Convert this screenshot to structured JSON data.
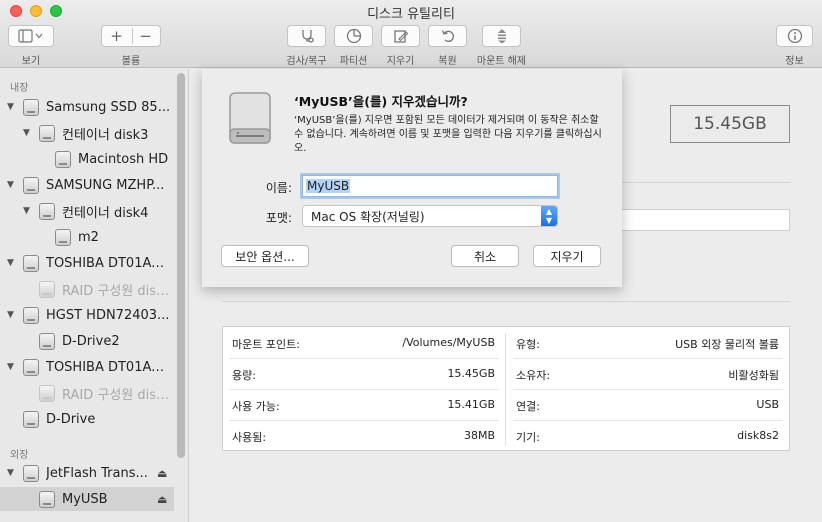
{
  "window": {
    "title": "디스크 유틸리티"
  },
  "toolbar": {
    "view_label": "보기",
    "volume_label": "볼륨",
    "first_aid_label": "검사/복구",
    "partition_label": "파티션",
    "erase_label": "지우기",
    "restore_label": "복원",
    "unmount_label": "마운트 해제",
    "info_label": "정보",
    "add_glyph": "+",
    "remove_glyph": "−"
  },
  "sidebar": {
    "internal_header": "내장",
    "external_header": "외장",
    "items": [
      {
        "label": "Samsung SSD 85..."
      },
      {
        "label": "컨테이너 disk3"
      },
      {
        "label": "Macintosh HD"
      },
      {
        "label": "SAMSUNG MZHP..."
      },
      {
        "label": "컨테이너 disk4"
      },
      {
        "label": "m2"
      },
      {
        "label": "TOSHIBA DT01AC..."
      },
      {
        "label": "RAID 구성원 disk..."
      },
      {
        "label": "HGST HDN72403..."
      },
      {
        "label": "D-Drive2"
      },
      {
        "label": "TOSHIBA DT01AC..."
      },
      {
        "label": "RAID 구성원 disk..."
      },
      {
        "label": "D-Drive"
      },
      {
        "label": "JetFlash Trans..."
      },
      {
        "label": "MyUSB"
      }
    ],
    "eject_glyph": "⏏"
  },
  "main": {
    "capacity": "15.45GB",
    "info": {
      "mount_point_label": "마운트 포인트:",
      "mount_point": "/Volumes/MyUSB",
      "type_label": "유형:",
      "type": "USB 외장 물리적 볼륨",
      "capacity_label": "용량:",
      "capacity": "15.45GB",
      "owners_label": "소유자:",
      "owners": "비활성화됨",
      "available_label": "사용 가능:",
      "available": "15.41GB",
      "connection_label": "연결:",
      "connection": "USB",
      "used_label": "사용됨:",
      "used": "38MB",
      "device_label": "기기:",
      "device": "disk8s2"
    }
  },
  "dialog": {
    "title": "‘MyUSB’을(를) 지우겠습니까?",
    "message": "‘MyUSB’을(를) 지우면 포함된 모든 데이터가 제거되며 이 동작은 취소할 수 없습니다. 계속하려면 이름 및 포맷을 입력한 다음 지우기를 클릭하십시오.",
    "name_label": "이름:",
    "name_value": "MyUSB",
    "format_label": "포맷:",
    "format_value": "Mac OS 확장(저널링)",
    "security_button": "보안 옵션...",
    "cancel_button": "취소",
    "erase_button": "지우기"
  }
}
